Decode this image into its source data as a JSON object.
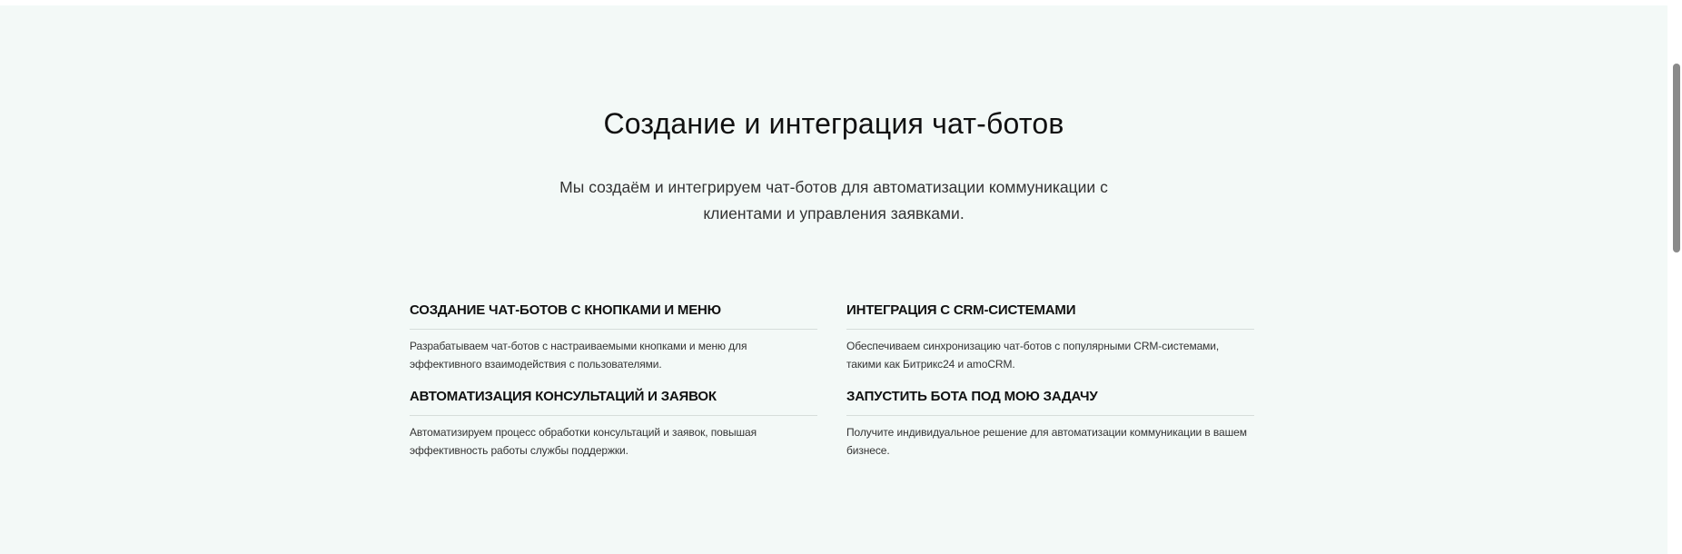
{
  "hero": {
    "title": "Создание и интеграция чат-ботов",
    "subtitle": "Мы создаём и интегрируем чат-ботов для автоматизации коммуникации с клиентами и управления заявками."
  },
  "features": [
    {
      "title": "СОЗДАНИЕ ЧАТ-БОТОВ С КНОПКАМИ И МЕНЮ",
      "description": "Разрабатываем чат-ботов с настраиваемыми кнопками и меню для эффективного взаимодействия с пользователями."
    },
    {
      "title": "ИНТЕГРАЦИЯ С CRM-СИСТЕМАМИ",
      "description": "Обеспечиваем синхронизацию чат-ботов с популярными CRM-системами, такими как Битрикс24 и amoCRM."
    },
    {
      "title": "АВТОМАТИЗАЦИЯ КОНСУЛЬТАЦИЙ И ЗАЯВОК",
      "description": "Автоматизируем процесс обработки консультаций и заявок, повышая эффективность работы службы поддержки."
    },
    {
      "title": "ЗАПУСТИТЬ БОТА ПОД МОЮ ЗАДАЧУ",
      "description": "Получите индивидуальное решение для автоматизации коммуникации в вашем бизнесе."
    }
  ],
  "colors": {
    "section_background": "#f3f9f7",
    "text_primary": "#111111",
    "divider": "#d6dedb"
  }
}
